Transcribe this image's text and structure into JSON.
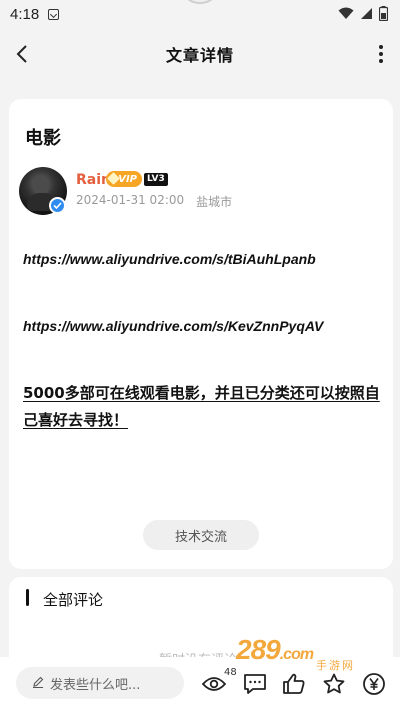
{
  "status_bar": {
    "time": "4:18"
  },
  "header": {
    "title": "文章详情"
  },
  "article": {
    "title": "电影",
    "author": {
      "name": "Rain",
      "vip_label": "VIP",
      "level_label": "LV3"
    },
    "date": "2024-01-31 02:00",
    "location": "盐城市",
    "links": [
      "https://www.aliyundrive.com/s/tBiAuhLpanb",
      "https://www.aliyundrive.com/s/KevZnnPyqAV"
    ],
    "body": "5000多部可在线观看电影，并且已分类还可以按照自己喜好去寻找！",
    "tag": "技术交流"
  },
  "comments": {
    "heading": "全部评论",
    "empty_hint": "暂时没有评论"
  },
  "bottom_bar": {
    "input_placeholder": "发表些什么吧...",
    "view_count": "48"
  },
  "watermark": {
    "brand": "289",
    "suffix": ".com",
    "sub": "手游网"
  },
  "colors": {
    "author_name": "#e35f3e",
    "vip_badge": "#f7a524",
    "verified": "#2f8cf0",
    "watermark": "#f19a1d"
  },
  "icons": [
    "back-arrow-icon",
    "more-vertical-icon",
    "verified-icon",
    "pen-icon",
    "eye-icon",
    "comment-icon",
    "like-icon",
    "star-icon",
    "yen-icon",
    "wifi-icon",
    "signal-icon",
    "battery-icon"
  ]
}
